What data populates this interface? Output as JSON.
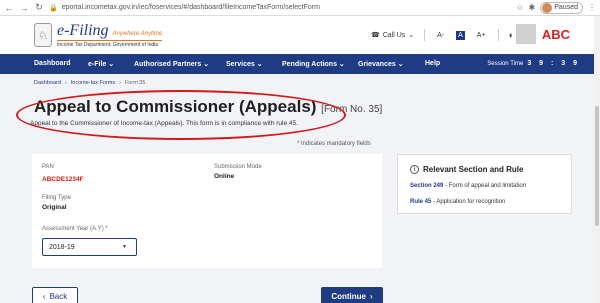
{
  "browser": {
    "url": "eportal.incometax.gov.in/iec/foservices/#/dashboard/fileIncomeTaxForm/selectForm",
    "profile_label": "Paused",
    "back_icon": "arrow-left-icon",
    "forward_icon": "arrow-right-icon",
    "reload_icon": "reload-icon"
  },
  "header": {
    "logo_main": "e-Filing",
    "logo_tag": "Anywhere Anytime",
    "logo_sub": "Income Tax Department, Government of India",
    "call_us": "Call Us",
    "font_small": "A-",
    "font_normal": "A",
    "font_large": "A+",
    "user_name": "ABC"
  },
  "nav": {
    "items": [
      "Dashboard",
      "e-File",
      "Authorised Partners",
      "Services",
      "Pending Actions",
      "Grievances",
      "Help"
    ],
    "session_label": "Session Time",
    "session_time": "3 9 : 3 9"
  },
  "breadcrumb": {
    "home": "Dashboard",
    "parent": "Income-tax Forms",
    "current": "Form 35"
  },
  "page": {
    "title": "Appeal to Commissioner (Appeals)",
    "form_no": "[Form No. 35]",
    "subtitle": "Appeal to the Commissioner of Income-tax (Appeals). This form is in compliance with rule 45.",
    "mandatory_note": "* Indicates mandatory fields"
  },
  "form": {
    "pan_label": "PAN",
    "pan_value": "ABCDE1234F",
    "submission_mode_label": "Submission Mode",
    "submission_mode_value": "Online",
    "filing_type_label": "Filing Type",
    "filing_type_value": "Original",
    "ay_label": "Assessment Year (A.Y) *",
    "ay_value": "2018-19"
  },
  "side": {
    "title": "Relevant Section and Rule",
    "section_link": "Section 249",
    "section_text": "- Form of appeal and limitation",
    "rule_link": "Rule 45",
    "rule_text": "- Application for recognition"
  },
  "buttons": {
    "back": "Back",
    "continue": "Continue"
  },
  "colors": {
    "primary": "#1f3b84",
    "accent": "#e27723",
    "highlight": "#d31a1a"
  }
}
